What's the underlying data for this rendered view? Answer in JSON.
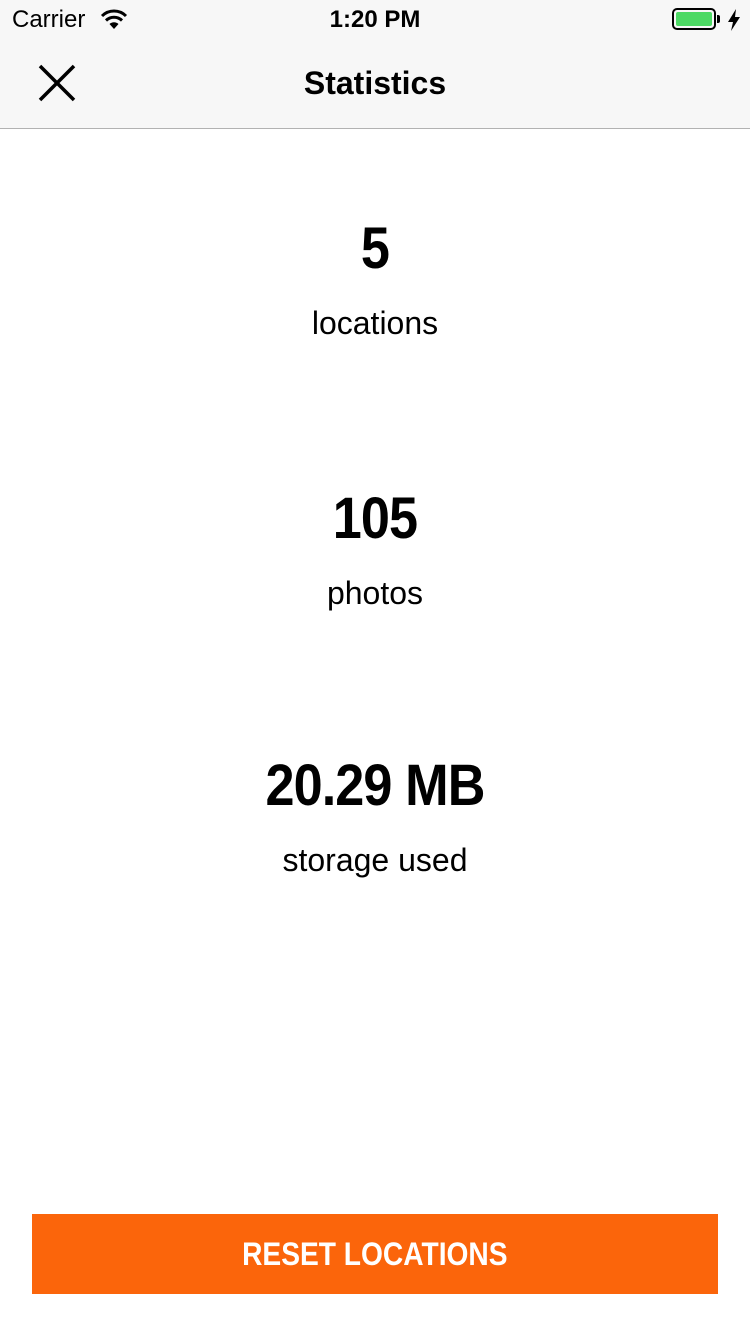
{
  "status_bar": {
    "carrier": "Carrier",
    "time": "1:20 PM",
    "battery_color": "#4cd964",
    "icons": [
      "wifi-icon",
      "battery-icon",
      "charging-bolt-icon"
    ]
  },
  "nav": {
    "title": "Statistics",
    "close_icon": "close-icon"
  },
  "stats": [
    {
      "value": "5",
      "label": "locations"
    },
    {
      "value": "105",
      "label": "photos"
    },
    {
      "value": "20.29 MB",
      "label": "storage used"
    }
  ],
  "reset_button": {
    "label": "RESET LOCATIONS",
    "color": "#fb650b"
  }
}
